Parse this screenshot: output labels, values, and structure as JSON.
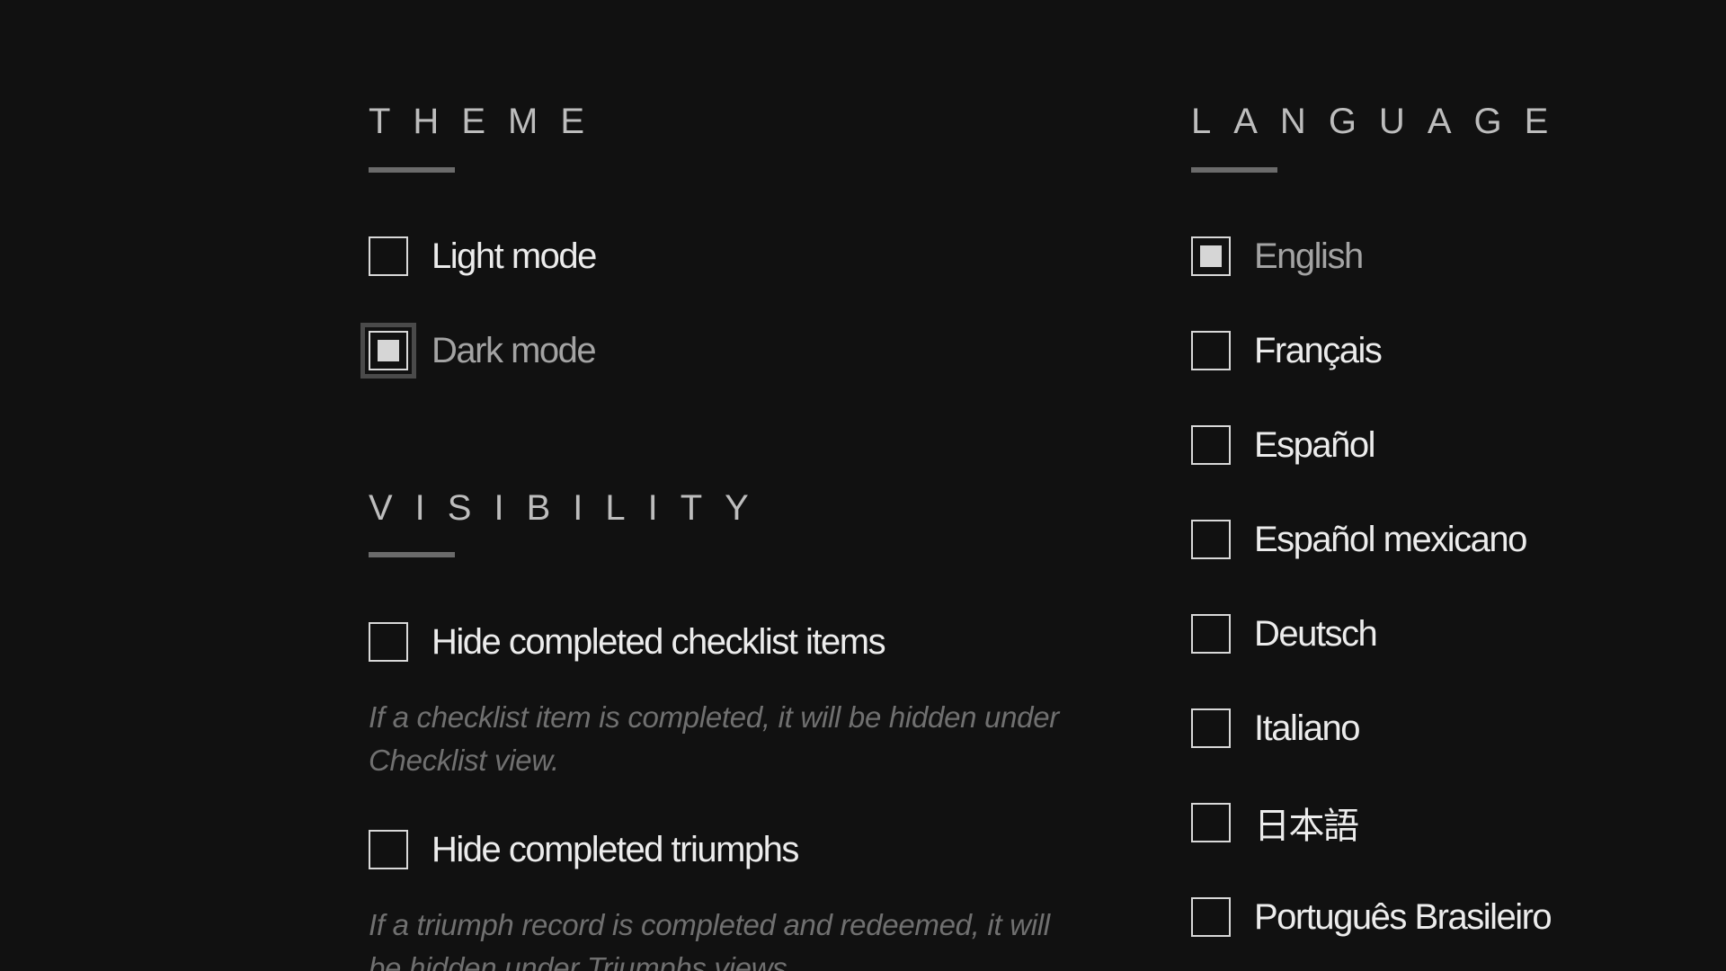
{
  "theme": {
    "title": "THEME",
    "options": [
      {
        "label": "Light mode",
        "checked": false
      },
      {
        "label": "Dark mode",
        "checked": true
      }
    ]
  },
  "visibility": {
    "title": "VISIBILITY",
    "options": [
      {
        "label": "Hide completed checklist items",
        "checked": false,
        "description": "If a checklist item is completed, it will be hidden under Checklist view."
      },
      {
        "label": "Hide completed triumphs",
        "checked": false,
        "description": "If a triumph record is completed and redeemed, it will be hidden under Triumphs views."
      }
    ]
  },
  "language": {
    "title": "LANGUAGE",
    "options": [
      {
        "label": "English",
        "checked": true
      },
      {
        "label": "Français",
        "checked": false
      },
      {
        "label": "Español",
        "checked": false
      },
      {
        "label": "Español mexicano",
        "checked": false
      },
      {
        "label": "Deutsch",
        "checked": false
      },
      {
        "label": "Italiano",
        "checked": false
      },
      {
        "label": "日本語",
        "checked": false
      },
      {
        "label": "Português Brasileiro",
        "checked": false
      }
    ]
  }
}
